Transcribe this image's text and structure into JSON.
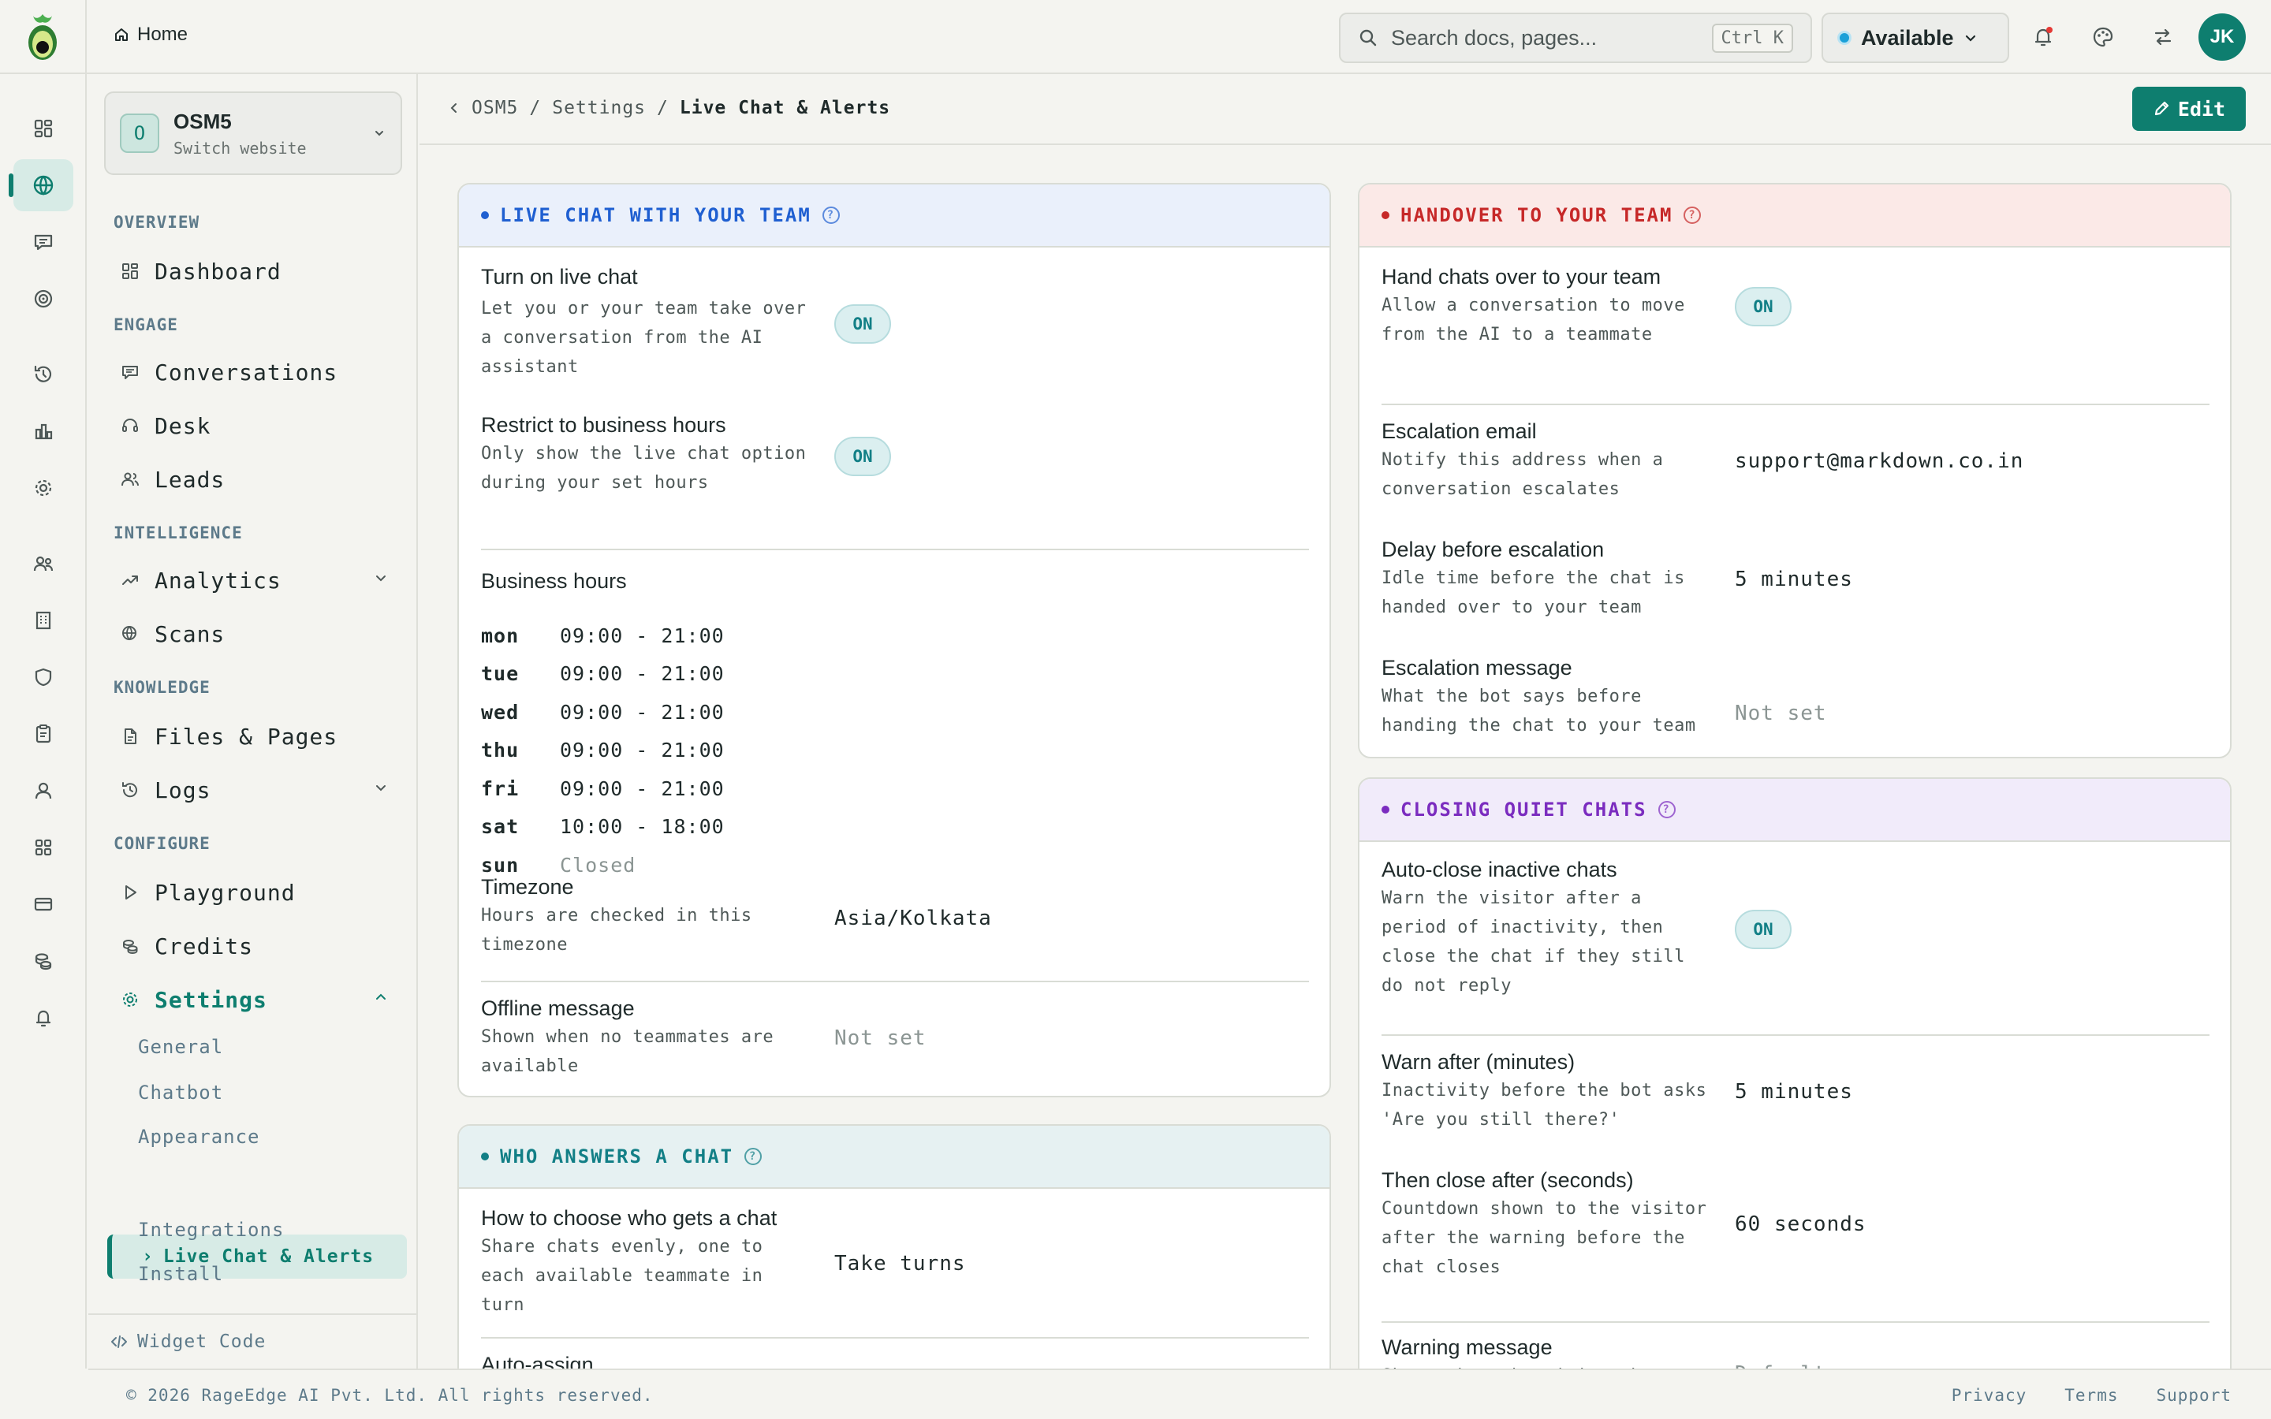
{
  "topbar": {
    "home_label": "Home",
    "search_placeholder": "Search docs, pages...",
    "search_shortcut": "Ctrl K",
    "status_label": "Available",
    "status_color": "#1aa0d8",
    "avatar_initials": "JK",
    "icons": [
      "bell-icon",
      "palette-icon",
      "arrows-swap-icon"
    ]
  },
  "rail": {
    "icons": [
      "dashboard-icon",
      "globe-icon",
      "chat-icon",
      "target-icon",
      "history-icon",
      "bar-chart-icon",
      "gear-icon",
      "team-icon",
      "building-icon",
      "shield-icon",
      "clipboard-icon",
      "user-icon",
      "apps-icon",
      "card-icon",
      "coins-icon",
      "bell-icon"
    ],
    "active_index": 1
  },
  "sidebar": {
    "site_initial": "O",
    "site_name": "OSM5",
    "site_sub": "Switch website",
    "sections": {
      "overview": "OVERVIEW",
      "engage": "ENGAGE",
      "intelligence": "INTELLIGENCE",
      "knowledge": "KNOWLEDGE",
      "configure": "CONFIGURE"
    },
    "items": {
      "dashboard": "Dashboard",
      "conversations": "Conversations",
      "desk": "Desk",
      "leads": "Leads",
      "analytics": "Analytics",
      "scans": "Scans",
      "files": "Files & Pages",
      "logs": "Logs",
      "playground": "Playground",
      "credits": "Credits",
      "settings": "Settings"
    },
    "settings_sub": {
      "general": "General",
      "chatbot": "Chatbot",
      "appearance": "Appearance",
      "live_chat": "Live Chat & Alerts",
      "integrations": "Integrations",
      "install": "Install"
    },
    "footer_label": "Widget Code"
  },
  "header": {
    "crumb_1": "OSM5",
    "sep": "/",
    "crumb_2": "Settings",
    "crumb_3": "Live Chat & Alerts",
    "edit_label": "Edit"
  },
  "live_chat": {
    "title": "LIVE CHAT WITH YOUR TEAM",
    "accent": "#1f5fd1",
    "turn_on_title": "Turn on live chat",
    "turn_on_desc": "Let you or your team take over a conversation from the AI assistant",
    "turn_on_value": "ON",
    "restrict_title": "Restrict to business hours",
    "restrict_desc": "Only show the live chat option during your set hours",
    "restrict_value": "ON",
    "hours_title": "Business hours",
    "hours": [
      {
        "day": "mon",
        "time": "09:00 - 21:00"
      },
      {
        "day": "tue",
        "time": "09:00 - 21:00"
      },
      {
        "day": "wed",
        "time": "09:00 - 21:00"
      },
      {
        "day": "thu",
        "time": "09:00 - 21:00"
      },
      {
        "day": "fri",
        "time": "09:00 - 21:00"
      },
      {
        "day": "sat",
        "time": "10:00 - 18:00"
      },
      {
        "day": "sun",
        "time": "Closed"
      }
    ],
    "timezone_title": "Timezone",
    "timezone_desc": "Hours are checked in this timezone",
    "timezone_value": "Asia/Kolkata",
    "offline_title": "Offline message",
    "offline_desc": "Shown when no teammates are available",
    "offline_value": "Not set"
  },
  "who_answers": {
    "title": "WHO ANSWERS A CHAT",
    "accent": "#127f86",
    "choose_title": "How to choose who gets a chat",
    "choose_desc": "Share chats evenly, one to each available teammate in turn",
    "choose_value": "Take turns",
    "auto_assign_title": "Auto-assign"
  },
  "handover": {
    "title": "HANDOVER TO YOUR TEAM",
    "accent": "#c62828",
    "hand_title": "Hand chats over to your team",
    "hand_desc": "Allow a conversation to move from the AI to a teammate",
    "hand_value": "ON",
    "email_title": "Escalation email",
    "email_desc": "Notify this address when a conversation escalates",
    "email_value": "support@markdown.co.in",
    "delay_title": "Delay before escalation",
    "delay_desc": "Idle time before the chat is handed over to your team",
    "delay_value": "5 minutes",
    "message_title": "Escalation message",
    "message_desc": "What the bot says before handing the chat to your team",
    "message_value": "Not set"
  },
  "closing": {
    "title": "CLOSING QUIET CHATS",
    "accent": "#7b2cbf",
    "auto_title": "Auto-close inactive chats",
    "auto_desc": "Warn the visitor after a period of inactivity, then close the chat if they still do not reply",
    "auto_value": "ON",
    "warn_title": "Warn after (minutes)",
    "warn_desc": "Inactivity before the bot asks 'Are you still there?'",
    "warn_value": "5 minutes",
    "close_title": "Then close after (seconds)",
    "close_desc": "Countdown shown to the visitor after the warning before the chat closes",
    "close_value": "60 seconds",
    "warning_title": "Warning message",
    "warning_desc": "Shown when the visitor has been inactive",
    "warning_value": "Default"
  },
  "footer": {
    "copyright": "© 2026 RageEdge AI Pvt. Ltd. All rights reserved.",
    "privacy": "Privacy",
    "terms": "Terms",
    "support": "Support"
  }
}
